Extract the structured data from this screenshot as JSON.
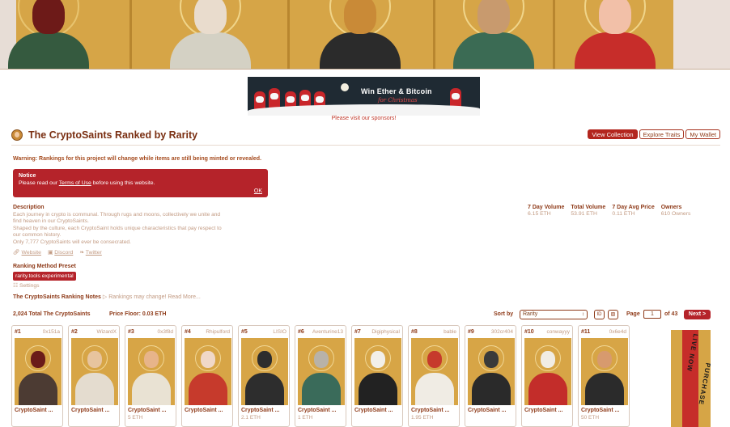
{
  "hero": {
    "saints": [
      {
        "halo": "#e8c46f",
        "head": "#6d1a18",
        "body": "#355a3f"
      },
      {
        "halo": "#f0d58a",
        "head": "#e9dccd",
        "body": "#d4d1c4"
      },
      {
        "halo": "#f0d58a",
        "head": "#c98a37",
        "body": "#2b2b2b"
      },
      {
        "halo": "#f0d58a",
        "head": "#c89a6e",
        "body": "#3b6b54"
      },
      {
        "halo": "#f0d58a",
        "head": "#f2c0a8",
        "body": "#c72d2a"
      }
    ]
  },
  "sponsor": {
    "title": "Win Ether & Bitcoin",
    "subtitle": "for Christmas",
    "note": "Please visit our sponsors!"
  },
  "header": {
    "title": "The CryptoSaints Ranked by Rarity",
    "buttons": [
      {
        "label": "View Collection"
      },
      {
        "label": "Explore Traits"
      },
      {
        "label": "My Wallet"
      }
    ]
  },
  "warning": "Warning: Rankings for this project will change while items are still being minted or revealed.",
  "notice": {
    "title": "Notice",
    "body_prefix": "Please read our ",
    "link": "Terms of Use",
    "body_suffix": " before using this website.",
    "ok": "OK"
  },
  "description": {
    "heading": "Description",
    "lines": [
      "Each journey in crypto is communal. Through rugs and moons, collectively we unite and",
      "find heaven in our CryptoSaints.",
      "Shaped by the culture, each CryptoSaint holds unique characteristics that pay respect to",
      "our common history.",
      "Only 7,777 CryptoSaints will ever be consecrated."
    ],
    "links": [
      "Website",
      "Discord",
      "Twitter"
    ]
  },
  "stats": [
    {
      "label": "7 Day Volume",
      "value": "6.15 ETH"
    },
    {
      "label": "Total Volume",
      "value": "53.91 ETH"
    },
    {
      "label": "7 Day Avg Price",
      "value": "0.11 ETH"
    },
    {
      "label": "Owners",
      "value": "610 Owners"
    }
  ],
  "ranking": {
    "preset_heading": "Ranking Method Preset",
    "preset_tag": "rarity.tools experimental",
    "settings": "Settings",
    "notes_title": "The CryptoSaints Ranking Notes",
    "notes_text": "Rankings may change! Read More..."
  },
  "toolbar": {
    "total": "2,024 Total The CryptoSaints",
    "floor": "Price Floor: 0.03 ETH",
    "sort_label": "Sort by",
    "sort_value": "Rarity",
    "view_icons": [
      "ID",
      "img"
    ],
    "page_label": "Page",
    "page_value": "1",
    "of_pages": "of 43",
    "next": "Next >"
  },
  "cards": [
    {
      "rank": "#1",
      "owner": "0x151a",
      "name": "CryptoSaint ...",
      "price": "",
      "head": "#6b1b19",
      "body": "#4c3b33"
    },
    {
      "rank": "#2",
      "owner": "WizardX",
      "name": "CryptoSaint ...",
      "price": "",
      "head": "#e7c49e",
      "body": "#e4dccf"
    },
    {
      "rank": "#3",
      "owner": "0x3f8d",
      "name": "CryptoSaint ...",
      "price": "5 ETH",
      "head": "#e7b48a",
      "body": "#e9e2d3"
    },
    {
      "rank": "#4",
      "owner": "Rhipulford",
      "name": "CryptoSaint ...",
      "price": "",
      "head": "#f0d8c8",
      "body": "#c63a2c"
    },
    {
      "rank": "#5",
      "owner": "LISIO",
      "name": "CryptoSaint ...",
      "price": "2.1 ETH",
      "head": "#2d2d2d",
      "body": "#2d2d2d"
    },
    {
      "rank": "#6",
      "owner": "Aventurine13",
      "name": "CryptoSaint ...",
      "price": "1 ETH",
      "head": "#b8b2a8",
      "body": "#3a6b5a"
    },
    {
      "rank": "#7",
      "owner": "Digiphysical",
      "name": "CryptoSaint ...",
      "price": "",
      "head": "#f2efe9",
      "body": "#222222"
    },
    {
      "rank": "#8",
      "owner": "bable",
      "name": "CryptoSaint ...",
      "price": "1.95 ETH",
      "head": "#c63a2c",
      "body": "#f0ece4"
    },
    {
      "rank": "#9",
      "owner": "302cr404",
      "name": "CryptoSaint ...",
      "price": "",
      "head": "#3a3a3a",
      "body": "#2a2a2a"
    },
    {
      "rank": "#10",
      "owner": "conwayyy",
      "name": "CryptoSaint ...",
      "price": "",
      "head": "#f1ede5",
      "body": "#c32d2a"
    },
    {
      "rank": "#11",
      "owner": "0x6e4d",
      "name": "CryptoSaint ...",
      "price": "50 ETH",
      "head": "#d79a6e",
      "body": "#2b2b2b"
    }
  ],
  "side_banner": {
    "text1": "LIVE NOW",
    "text2": "PURCHASE"
  }
}
